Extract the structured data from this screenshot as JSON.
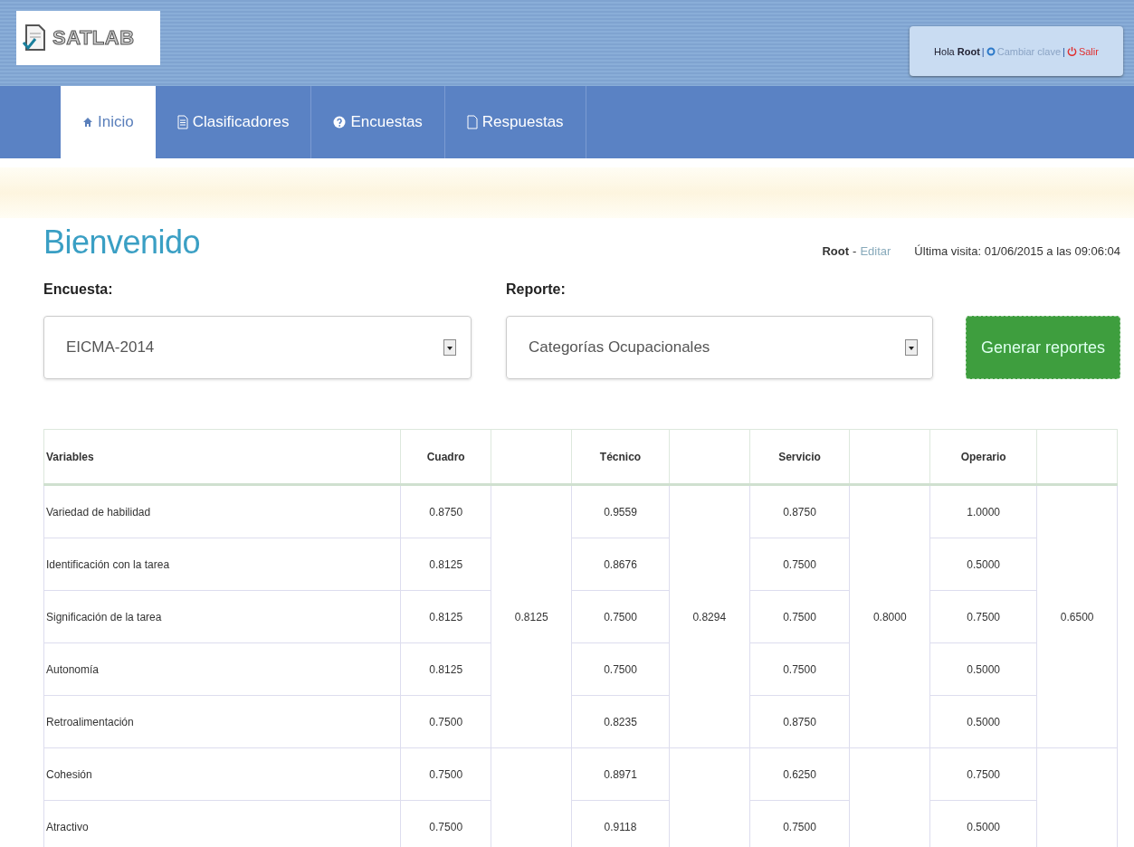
{
  "header": {
    "logo": "SATLAB",
    "user_menu": {
      "greeting": "Hola **Root**",
      "separator": "|",
      "change_password": "Cambiar clave",
      "separator_2": "|",
      "logout": "Salir"
    }
  },
  "nav": {
    "tabs": [
      {
        "label": "Inicio",
        "selected": true
      },
      {
        "label": "Clasificadores",
        "selected": false
      },
      {
        "label": "Encuestas",
        "selected": false
      },
      {
        "label": "Respuestas",
        "selected": false
      }
    ]
  },
  "page": {
    "title": "Bienvenido",
    "user": "Root",
    "dash": "-",
    "edit_link": "Editar",
    "last_visit": "Última visita: 01/06/2015 a las 09:06:04"
  },
  "form": {
    "survey": {
      "label": "Encuesta:",
      "value": "EICMA-2014"
    },
    "report": {
      "label": "Reporte:",
      "value": "Categorías Ocupacionales"
    },
    "generate_button": "Generar reportes"
  },
  "table": {
    "columns": [
      "Variables",
      "Cuadro",
      "Técnico",
      "Servicio",
      "Operario"
    ],
    "group_scores": [
      "0.8125",
      "0.8294",
      "0.8000",
      "0.6500"
    ],
    "rows": [
      {
        "variable": "Variedad de habilidad",
        "values": [
          "0.8750",
          "0.9559",
          "0.8750",
          "1.0000"
        ]
      },
      {
        "variable": "Identificación con la tarea",
        "values": [
          "0.8125",
          "0.8676",
          "0.7500",
          "0.5000"
        ]
      },
      {
        "variable": "Significación de la tarea",
        "values": [
          "0.8125",
          "0.7500",
          "0.7500",
          "0.7500"
        ]
      },
      {
        "variable": "Autonomía",
        "values": [
          "0.8125",
          "0.7500",
          "0.7500",
          "0.5000"
        ]
      },
      {
        "variable": "Retroalimentación",
        "values": [
          "0.7500",
          "0.8235",
          "0.8750",
          "0.5000"
        ]
      },
      {
        "variable": "Cohesión",
        "values": [
          "0.7500",
          "0.8971",
          "0.6250",
          "0.7500"
        ]
      },
      {
        "variable": "Atractivo",
        "values": [
          "0.7500",
          "0.9118",
          "0.7500",
          "0.5000"
        ]
      }
    ]
  }
}
